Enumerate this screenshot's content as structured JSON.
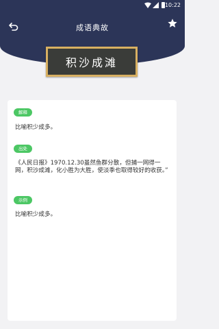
{
  "status_bar": {
    "time": "10:22"
  },
  "header": {
    "title": "成语典故"
  },
  "idiom": {
    "word": "积沙成滩"
  },
  "sections": [
    {
      "label": "解释",
      "text": "比喻积少成多。"
    },
    {
      "label": "出处",
      "text": "《人民日报》1970.12.30虽然鱼群分散，但捕一网得一网，积沙成滩，化小胜为大胜，使淡季也取得较好的收获。”"
    },
    {
      "label": "示例",
      "text": "比喻积少成多。"
    }
  ],
  "colors": {
    "header_bg": "#2c3558",
    "tag_green": "#4cc764",
    "board_frame": "#d8b062"
  }
}
